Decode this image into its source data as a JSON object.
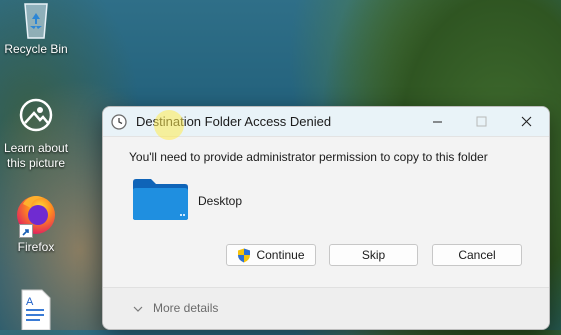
{
  "desktop": {
    "icons": [
      {
        "label": "Recycle Bin"
      },
      {
        "label": "Learn about\nthis picture"
      },
      {
        "label": "Firefox"
      }
    ]
  },
  "dialog": {
    "title": "Destination Folder Access Denied",
    "message": "You'll need to provide administrator permission to copy to this folder",
    "folder_name": "Desktop",
    "buttons": {
      "continue": "Continue",
      "skip": "Skip",
      "cancel": "Cancel"
    },
    "more_details": "More details"
  },
  "colors": {
    "folder_blue": "#1f8fe0",
    "shield_yellow": "#f4c20d",
    "shield_blue": "#2b6fd6"
  }
}
